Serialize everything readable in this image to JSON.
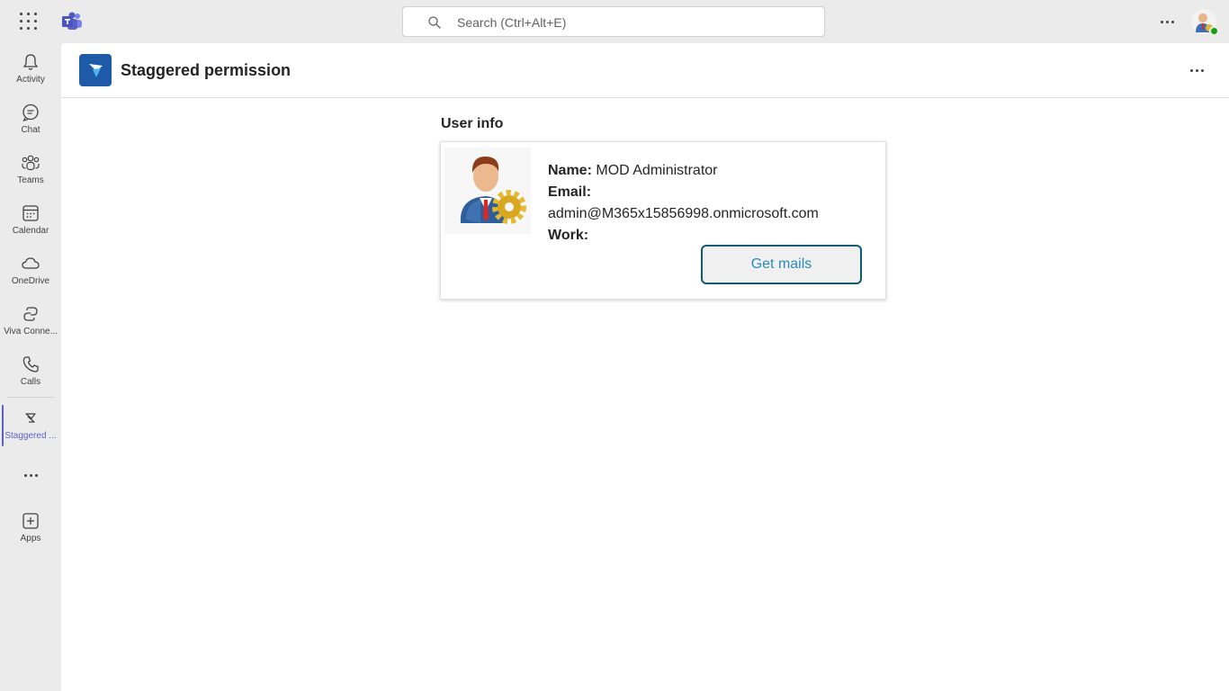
{
  "topbar": {
    "search_placeholder": "Search (Ctrl+Alt+E)",
    "icons": [
      "app-launcher-icon",
      "teams-logo-icon",
      "search-icon",
      "more-options-icon",
      "profile-avatar-icon"
    ]
  },
  "rail": {
    "items": [
      {
        "label": "Activity",
        "icon": "bell-icon"
      },
      {
        "label": "Chat",
        "icon": "chat-icon"
      },
      {
        "label": "Teams",
        "icon": "teams-icon"
      },
      {
        "label": "Calendar",
        "icon": "calendar-icon"
      },
      {
        "label": "OneDrive",
        "icon": "cloud-icon"
      },
      {
        "label": "Viva Conne...",
        "icon": "viva-connections-icon"
      },
      {
        "label": "Calls",
        "icon": "phone-icon"
      },
      {
        "label": "Staggered ...",
        "icon": "staggered-app-icon",
        "active": true
      },
      {
        "label": "Apps",
        "icon": "add-app-icon"
      }
    ],
    "accent": "#5b5fc7"
  },
  "app": {
    "title": "Staggered permission",
    "icon_color": "#1e5aa8"
  },
  "user_info": {
    "section_title": "User info",
    "name_label": "Name:",
    "name_value": "MOD Administrator",
    "email_label": "Email:",
    "email_value": "admin@M365x15856998.onmicrosoft.com",
    "work_label": "Work:",
    "button_label": "Get mails"
  }
}
